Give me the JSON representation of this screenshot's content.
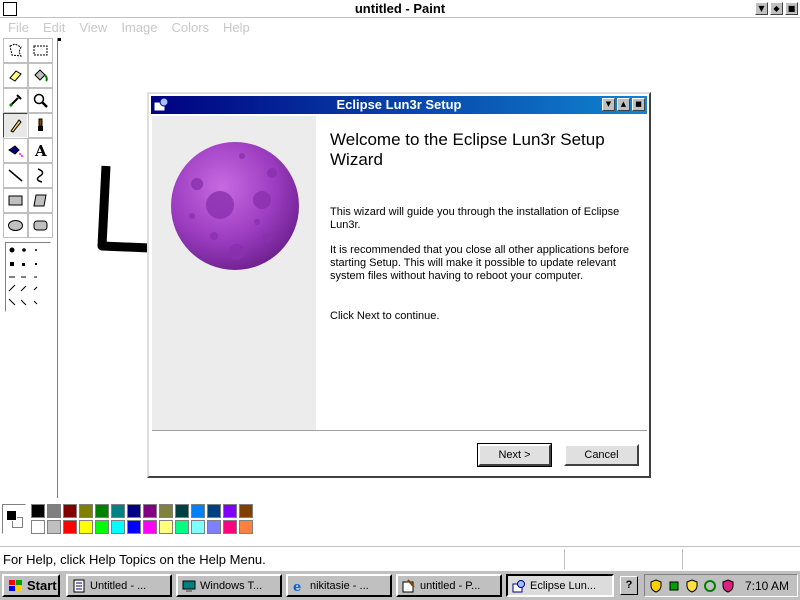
{
  "paint": {
    "title": "untitled - Paint",
    "menus": [
      "File",
      "Edit",
      "View",
      "Image",
      "Colors",
      "Help"
    ],
    "status_text": "For Help, click Help Topics on the Help Menu.",
    "tools": [
      "free-select-icon",
      "rect-select-icon",
      "eraser-icon",
      "fill-icon",
      "color-picker-icon",
      "magnifier-icon",
      "pencil-icon",
      "brush-icon",
      "airbrush-icon",
      "text-icon",
      "line-icon",
      "curve-icon",
      "rectangle-icon",
      "polygon-icon",
      "ellipse-icon",
      "rounded-rect-icon"
    ],
    "active_tool": "pencil-icon",
    "palette_top": [
      "#000000",
      "#808080",
      "#800000",
      "#808000",
      "#008000",
      "#008080",
      "#000080",
      "#800080",
      "#808040",
      "#004040",
      "#0080ff",
      "#004080",
      "#8000ff",
      "#804000"
    ],
    "palette_bottom": [
      "#ffffff",
      "#c0c0c0",
      "#ff0000",
      "#ffff00",
      "#00ff00",
      "#00ffff",
      "#0000ff",
      "#ff00ff",
      "#ffff80",
      "#00ff80",
      "#80ffff",
      "#8080ff",
      "#ff0080",
      "#ff8040"
    ],
    "foreground_color": "#000000",
    "background_color": "#ffffff"
  },
  "dialog": {
    "title": "Eclipse Lun3r Setup",
    "heading": "Welcome to the Eclipse Lun3r Setup Wizard",
    "paragraph1": "This wizard will guide you through the installation of Eclipse Lun3r.",
    "paragraph2": "It is recommended that you close all other applications before starting Setup. This will make it possible to update relevant system files without having to reboot your computer.",
    "paragraph3": "Click Next to continue.",
    "next_label": "Next >",
    "cancel_label": "Cancel"
  },
  "taskbar": {
    "start_label": "Start",
    "tasks": [
      "Untitled - ...",
      "Windows T...",
      "nikitasie - ...",
      "untitled - P...",
      "Eclipse Lun..."
    ],
    "active_task": "Eclipse Lun...",
    "help_label": "?",
    "clock": "7:10 AM"
  }
}
